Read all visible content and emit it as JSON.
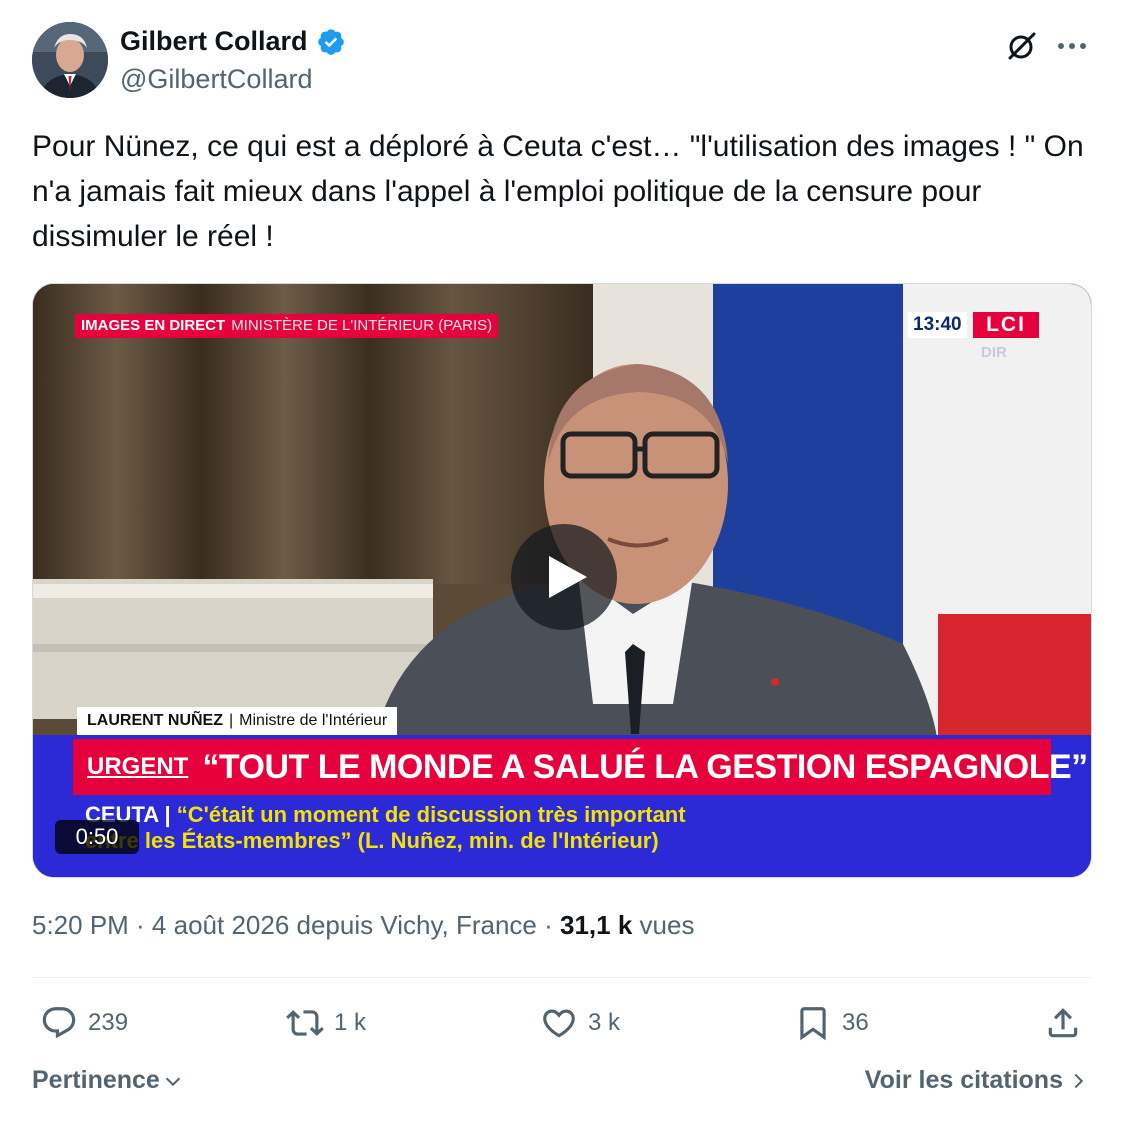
{
  "author": {
    "display_name": "Gilbert Collard",
    "handle": "@GilbertCollard",
    "verified": true
  },
  "tweet": {
    "text": "Pour Nünez, ce qui est a déploré à Ceuta c'est… \"l'utilisation des images ! \" On n'a jamais fait mieux dans l'appel à l'emploi politique de la censure pour dissimuler le réel !"
  },
  "video": {
    "live_tag": "IMAGES EN DIRECT",
    "location_tag": "MINISTÈRE DE L'INTÉRIEUR (PARIS)",
    "clock": "13:40",
    "channel": "LCI",
    "channel_sub": "DIR",
    "speaker_name": "LAURENT NUÑEZ",
    "speaker_title": "Ministre de l'Intérieur",
    "urgent_label": "URGENT",
    "headline": "“TOUT LE MONDE A SALUÉ LA GESTION ESPAGNOLE”",
    "ticker_place": "CEUTA |",
    "ticker_line1": "“C'était un moment de discussion très important",
    "ticker_line2": "entre les États-membres” (L. Nuñez, min. de l'Intérieur)",
    "duration": "0:50"
  },
  "meta": {
    "time_place": "5:20 PM · 4 août 2026 depuis Vichy, France ·",
    "views_count": "31,1 k",
    "views_label": "vues"
  },
  "actions": {
    "replies": "239",
    "reposts": "1 k",
    "likes": "3 k",
    "bookmarks": "36"
  },
  "footer": {
    "sort_label": "Pertinence",
    "quotes_link": "Voir les citations"
  },
  "colors": {
    "verified_blue": "#1d9bf0",
    "lci_red": "#e6003c",
    "lower_band_blue": "#2b2ad6",
    "muted_text": "#536471"
  }
}
